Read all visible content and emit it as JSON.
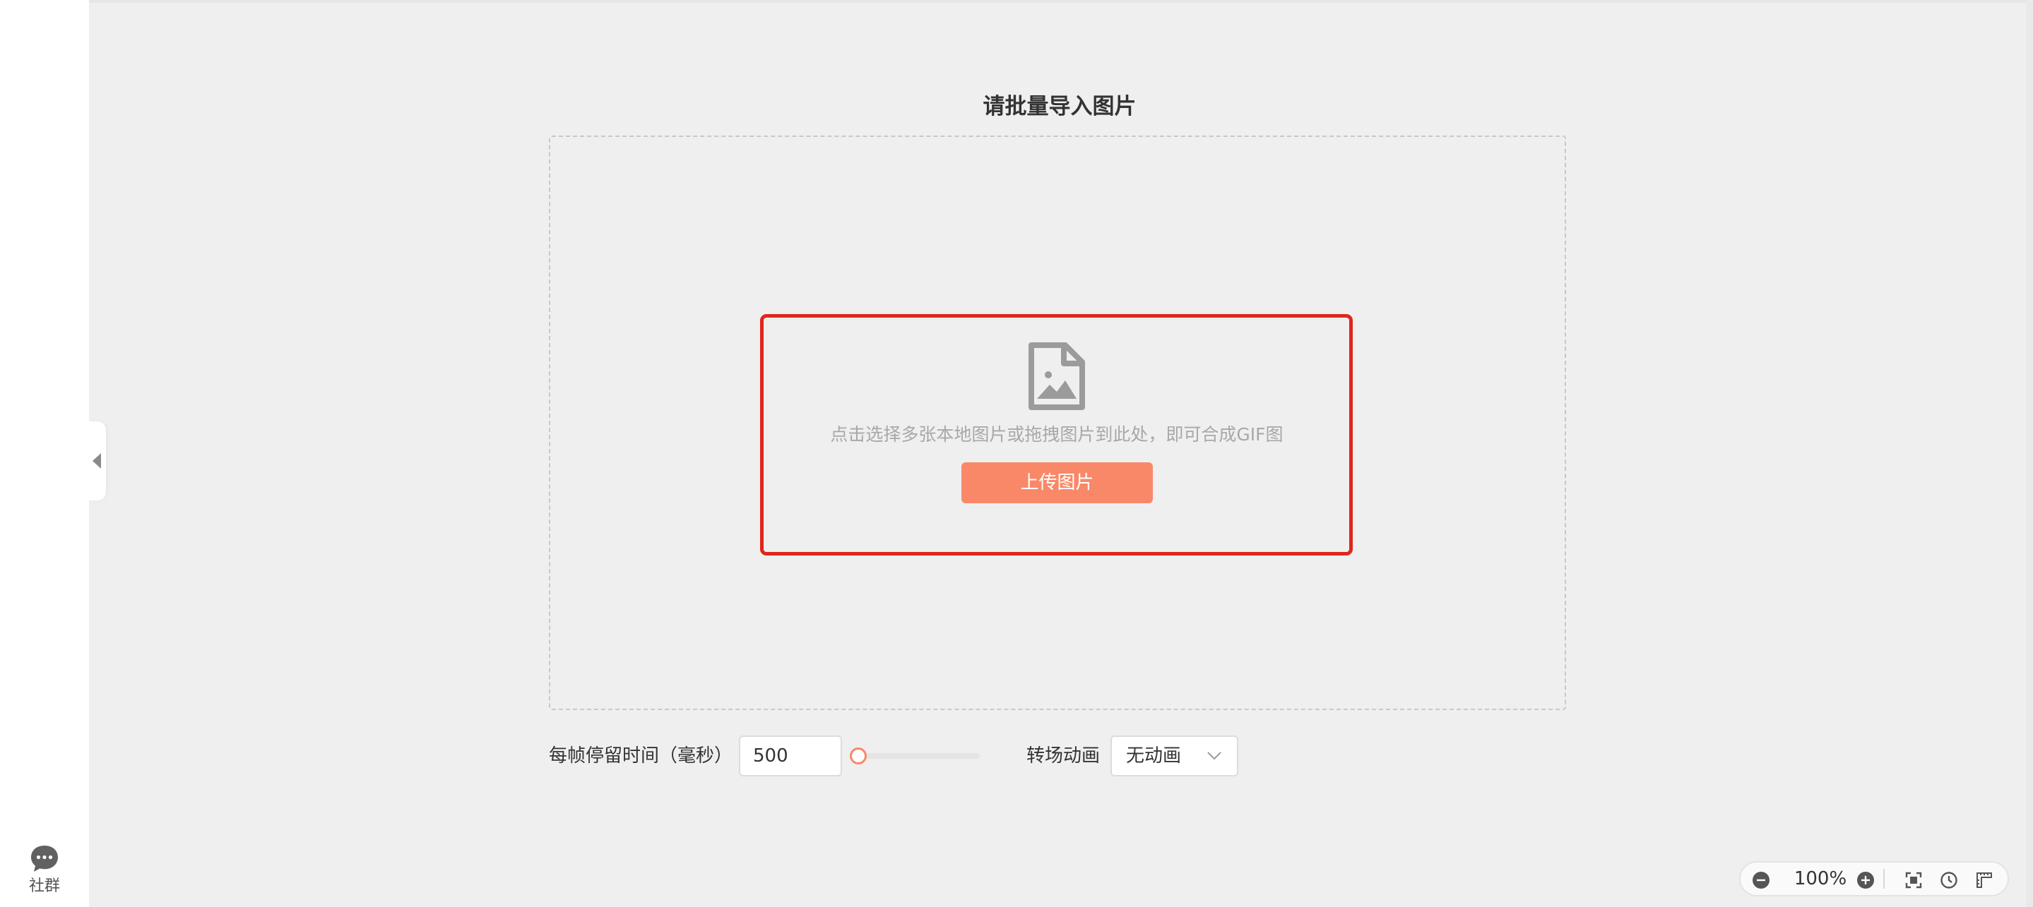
{
  "sidebar": {
    "community_label": "社群"
  },
  "main": {
    "title": "请批量导入图片",
    "dropzone": {
      "hint": "点击选择多张本地图片或拖拽图片到此处，即可合成GIF图",
      "upload_button": "上传图片"
    }
  },
  "settings": {
    "frame_time_label": "每帧停留时间（毫秒）",
    "frame_time_value": "500",
    "frame_time_slider_fraction": 0.0,
    "transition_label": "转场动画",
    "transition_value": "无动画"
  },
  "zoom": {
    "level": "100%"
  },
  "colors": {
    "accent": "#f98868",
    "highlight_border": "#e0261b",
    "background": "#efefef"
  },
  "icons": [
    "comment-icon",
    "collapse-arrow-icon",
    "image-file-icon",
    "chevron-down-icon",
    "zoom-out-icon",
    "zoom-in-icon",
    "fit-screen-icon",
    "history-icon",
    "ruler-icon"
  ]
}
